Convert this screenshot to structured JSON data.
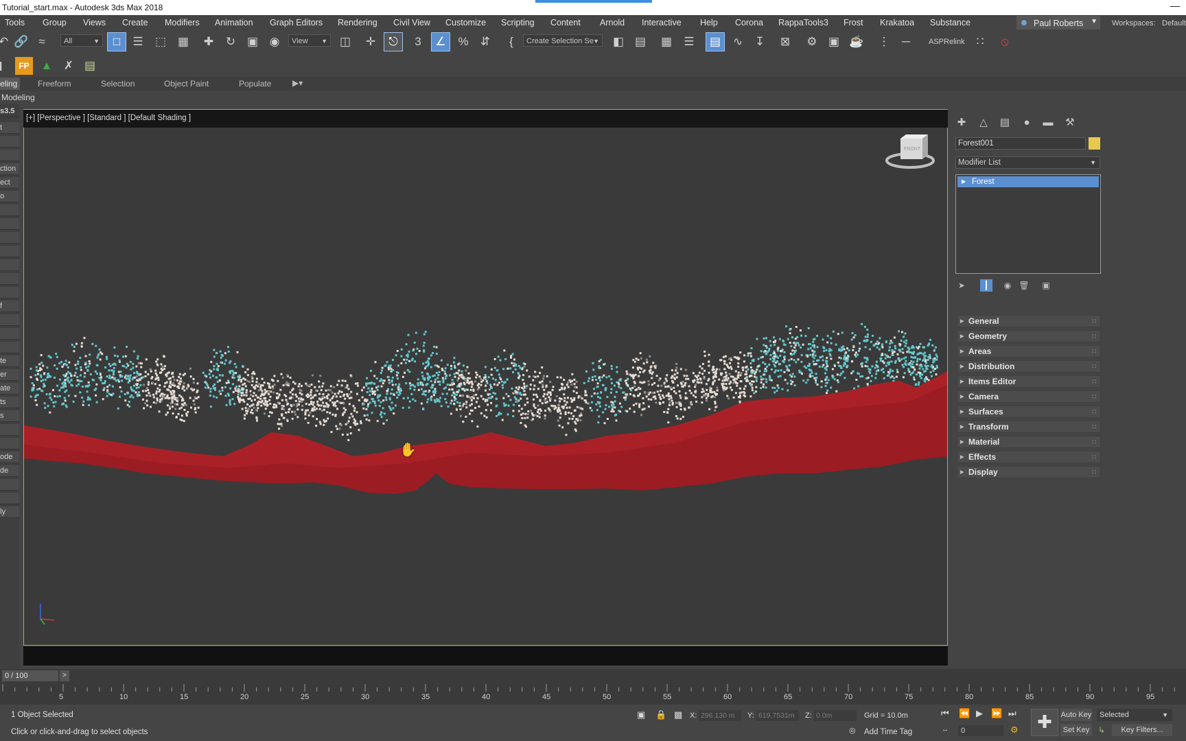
{
  "window": {
    "title": "Tutorial_start.max - Autodesk 3ds Max 2018",
    "minimize_glyph": "—"
  },
  "menu": [
    "Tools",
    "Group",
    "Views",
    "Create",
    "Modifiers",
    "Animation",
    "Graph Editors",
    "Rendering",
    "Civil View",
    "Customize",
    "Scripting",
    "Content",
    "Arnold",
    "Interactive",
    "Help",
    "Corona",
    "RappaTools3",
    "Frost",
    "Krakatoa",
    "Substance"
  ],
  "user": {
    "name": "Paul Roberts"
  },
  "workspace": {
    "label": "Workspaces:",
    "value": "Default"
  },
  "toolbar": {
    "selection_filter": "All",
    "ref_coord": "View",
    "named_selection": "Create Selection Se",
    "aspr_label": "ASPRelink",
    "fp_label": "FP"
  },
  "ribbon": {
    "tabs": [
      "eling",
      "Freeform",
      "Selection",
      "Object Paint",
      "Populate"
    ],
    "panel_label": "Modeling"
  },
  "left_panel": {
    "items": [
      "s3.5",
      "t",
      "",
      "",
      "ction",
      "ect",
      "o",
      "",
      "",
      "",
      "",
      "",
      "",
      "",
      "f",
      "",
      "",
      "",
      "te",
      "er",
      "ate",
      "ts",
      "s",
      "",
      "",
      "ode",
      "de",
      "",
      "",
      "ly"
    ]
  },
  "viewport": {
    "label": "[+] [Perspective ] [Standard ] [Default Shading ]",
    "viewcube_face": "FRONT"
  },
  "command_panel": {
    "object_name": "Forest001",
    "object_color": "#e8c851",
    "modifier_list_label": "Modifier List",
    "stack_items": [
      "Forest"
    ],
    "rollouts": [
      "General",
      "Geometry",
      "Areas",
      "Distribution",
      "Items Editor",
      "Camera",
      "Surfaces",
      "Transform",
      "Material",
      "Effects",
      "Display"
    ]
  },
  "timeline": {
    "frame_display": "0 / 100",
    "next_label": ">",
    "ticks": [
      "5",
      "10",
      "15",
      "20",
      "25",
      "30",
      "35",
      "40",
      "45",
      "50",
      "55",
      "60",
      "65",
      "70",
      "75",
      "80",
      "85",
      "90",
      "95"
    ]
  },
  "status": {
    "selection_count": "1 Object Selected",
    "prompt": "Click or click-and-drag to select objects",
    "x_label": "X:",
    "x_value": "296.130 m",
    "y_label": "Y:",
    "y_value": "619.7531m",
    "z_label": "Z:",
    "z_value": "0.0m",
    "grid": "Grid = 10.0m",
    "add_time_tag": "Add Time Tag",
    "auto_key": "Auto Key",
    "set_key": "Set Key",
    "key_mode": "Selected",
    "key_filters": "Key Filters...",
    "current_frame": "0"
  },
  "colors": {
    "accent": "#5b8fd1",
    "viewport_border": "#c9a43a",
    "terrain": "#9b1c22",
    "foliage_teal": "#63c7cd",
    "foliage_white": "#e7ddd4"
  }
}
